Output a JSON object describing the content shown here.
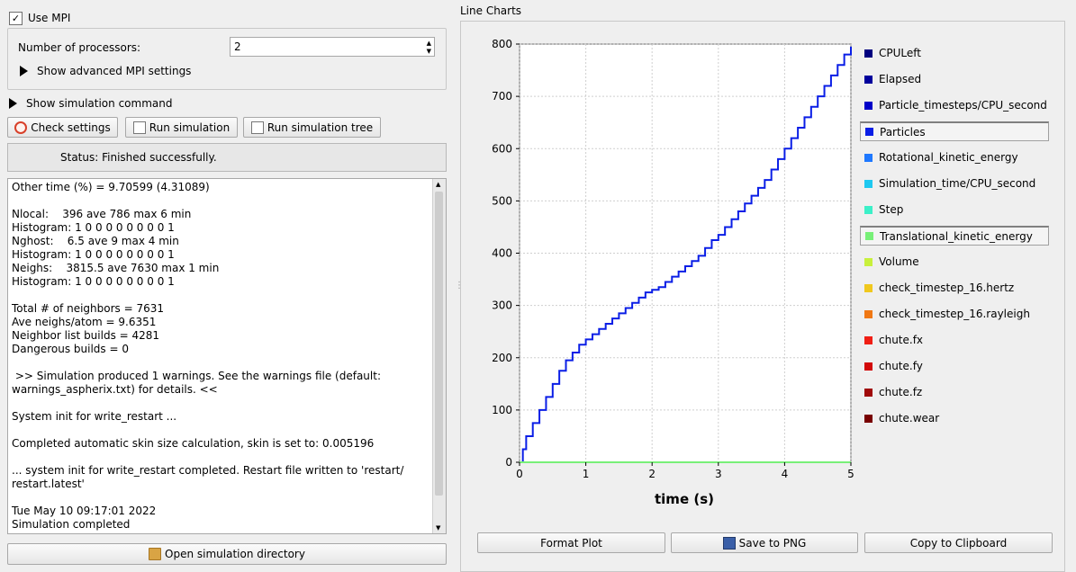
{
  "left": {
    "use_mpi_label": "Use MPI",
    "use_mpi_checked": true,
    "num_proc_label": "Number of processors:",
    "num_proc_value": "2",
    "adv_mpi_label": "Show advanced MPI settings",
    "sim_cmd_label": "Show simulation command",
    "check_settings": "Check settings",
    "run_simulation": "Run simulation",
    "run_simulation_tree": "Run simulation tree",
    "status": "Status: Finished successfully.",
    "log_lines": [
      "Other time (%) = 9.70599 (4.31089)",
      "",
      "Nlocal:    396 ave 786 max 6 min",
      "Histogram: 1 0 0 0 0 0 0 0 0 1",
      "Nghost:    6.5 ave 9 max 4 min",
      "Histogram: 1 0 0 0 0 0 0 0 0 1",
      "Neighs:    3815.5 ave 7630 max 1 min",
      "Histogram: 1 0 0 0 0 0 0 0 0 1",
      "",
      "Total # of neighbors = 7631",
      "Ave neighs/atom = 9.6351",
      "Neighbor list builds = 4281",
      "Dangerous builds = 0",
      "",
      " >> Simulation produced 1 warnings. See the warnings file (default:",
      "warnings_aspherix.txt) for details. <<",
      "",
      "System init for write_restart ...",
      "",
      "Completed automatic skin size calculation, skin is set to: 0.005196",
      "",
      "... system init for write_restart completed. Restart file written to 'restart/",
      "restart.latest'",
      "",
      "Tue May 10 09:17:01 2022",
      "Simulation completed"
    ],
    "open_dir": "Open simulation directory"
  },
  "right": {
    "panel_title": "Line Charts",
    "format_plot": "Format Plot",
    "save_png": "Save to PNG",
    "copy_clipboard": "Copy to Clipboard"
  },
  "legend": [
    {
      "label": "CPULeft",
      "color": "#00007f",
      "selected": false
    },
    {
      "label": "Elapsed",
      "color": "#00009c",
      "selected": false
    },
    {
      "label": "Particle_timesteps/CPU_second",
      "color": "#0000c8",
      "selected": false
    },
    {
      "label": "Particles",
      "color": "#0a1ee6",
      "selected": true
    },
    {
      "label": "Rotational_kinetic_energy",
      "color": "#1e78ff",
      "selected": false
    },
    {
      "label": "Simulation_time/CPU_second",
      "color": "#1ec8f0",
      "selected": false
    },
    {
      "label": "Step",
      "color": "#3cf0c8",
      "selected": false
    },
    {
      "label": "Translational_kinetic_energy",
      "color": "#78f078",
      "selected": true
    },
    {
      "label": "Volume",
      "color": "#c8f03c",
      "selected": false
    },
    {
      "label": "check_timestep_16.hertz",
      "color": "#f0c81e",
      "selected": false
    },
    {
      "label": "check_timestep_16.rayleigh",
      "color": "#f07814",
      "selected": false
    },
    {
      "label": "chute.fx",
      "color": "#f01e14",
      "selected": false
    },
    {
      "label": "chute.fy",
      "color": "#d20a0a",
      "selected": false
    },
    {
      "label": "chute.fz",
      "color": "#a00a0a",
      "selected": false
    },
    {
      "label": "chute.wear",
      "color": "#780000",
      "selected": false
    }
  ],
  "chart_data": {
    "type": "line",
    "xlabel": "time (s)",
    "ylabel": "",
    "xlim": [
      0,
      5
    ],
    "ylim": [
      0,
      800
    ],
    "xticks": [
      "0",
      "1",
      "2",
      "3",
      "4",
      "5"
    ],
    "yticks": [
      "0",
      "100",
      "200",
      "300",
      "400",
      "500",
      "600",
      "700",
      "800"
    ],
    "grid": true,
    "series": [
      {
        "name": "Particles",
        "color": "#0a1ee6",
        "x": [
          0,
          0.05,
          0.1,
          0.2,
          0.3,
          0.4,
          0.5,
          0.6,
          0.7,
          0.8,
          0.9,
          1.0,
          1.1,
          1.2,
          1.3,
          1.4,
          1.5,
          1.6,
          1.7,
          1.8,
          1.9,
          2.0,
          2.1,
          2.2,
          2.3,
          2.4,
          2.5,
          2.6,
          2.7,
          2.8,
          2.9,
          3.0,
          3.1,
          3.2,
          3.3,
          3.4,
          3.5,
          3.6,
          3.7,
          3.8,
          3.9,
          4.0,
          4.1,
          4.2,
          4.3,
          4.4,
          4.5,
          4.6,
          4.7,
          4.8,
          4.9,
          5.0
        ],
        "values": [
          0,
          25,
          50,
          75,
          100,
          125,
          150,
          175,
          195,
          210,
          225,
          235,
          245,
          255,
          265,
          275,
          285,
          295,
          305,
          315,
          325,
          330,
          335,
          345,
          355,
          365,
          375,
          385,
          395,
          410,
          425,
          435,
          450,
          465,
          480,
          495,
          510,
          525,
          540,
          560,
          580,
          600,
          620,
          640,
          660,
          680,
          700,
          720,
          740,
          760,
          780,
          795
        ]
      },
      {
        "name": "Translational_kinetic_energy",
        "color": "#78f078",
        "x": [
          0,
          5
        ],
        "values": [
          0,
          0
        ]
      }
    ]
  }
}
